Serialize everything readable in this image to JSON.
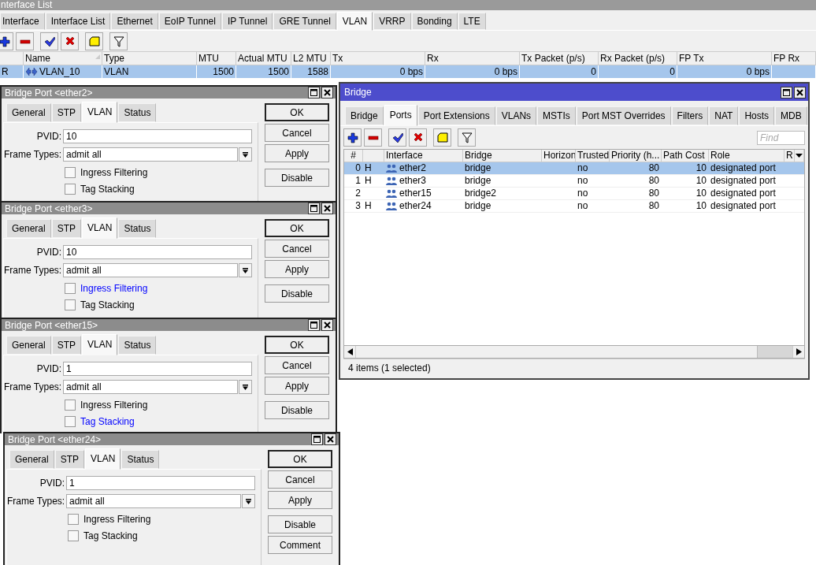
{
  "interface_list": {
    "title": "nterface List",
    "tabs": [
      {
        "label": "Interface",
        "selected": false
      },
      {
        "label": "Interface List",
        "selected": false
      },
      {
        "label": "Ethernet",
        "selected": false
      },
      {
        "label": "EoIP Tunnel",
        "selected": false
      },
      {
        "label": "IP Tunnel",
        "selected": false
      },
      {
        "label": "GRE Tunnel",
        "selected": false
      },
      {
        "label": "VLAN",
        "selected": true
      },
      {
        "label": "VRRP",
        "selected": false
      },
      {
        "label": "Bonding",
        "selected": false
      },
      {
        "label": "LTE",
        "selected": false
      }
    ],
    "table": {
      "columns": [
        "Name",
        "Type",
        "MTU",
        "Actual MTU",
        "L2 MTU",
        "Tx",
        "Rx",
        "Tx Packet (p/s)",
        "Rx Packet (p/s)",
        "FP Tx",
        "FP Rx"
      ],
      "rows": [
        {
          "flag": "R",
          "selected": true,
          "cells": [
            "VLAN_10",
            "VLAN",
            "1500",
            "1500",
            "1588",
            "0 bps",
            "0 bps",
            "0",
            "0",
            "0 bps"
          ]
        }
      ]
    }
  },
  "bridge": {
    "title": "Bridge",
    "tabs": [
      {
        "label": "Bridge",
        "selected": false
      },
      {
        "label": "Ports",
        "selected": true
      },
      {
        "label": "Port Extensions",
        "selected": false
      },
      {
        "label": "VLANs",
        "selected": false
      },
      {
        "label": "MSTIs",
        "selected": false
      },
      {
        "label": "Port MST Overrides",
        "selected": false
      },
      {
        "label": "Filters",
        "selected": false
      },
      {
        "label": "NAT",
        "selected": false
      },
      {
        "label": "Hosts",
        "selected": false
      },
      {
        "label": "MDB",
        "selected": false
      }
    ],
    "search": {
      "placeholder": "Find"
    },
    "table": {
      "columns": [
        "#",
        "Interface",
        "Bridge",
        "Horizon",
        "Trusted",
        "Priority (h...",
        "Path Cost",
        "Role",
        "R"
      ],
      "rows": [
        {
          "number": "0",
          "flag": "H",
          "interface": "ether2",
          "bridge": "bridge",
          "trusted": "no",
          "priority": "80",
          "path_cost": "10",
          "role": "designated port",
          "selected": true
        },
        {
          "number": "1",
          "flag": "H",
          "interface": "ether3",
          "bridge": "bridge",
          "trusted": "no",
          "priority": "80",
          "path_cost": "10",
          "role": "designated port",
          "selected": false
        },
        {
          "number": "2",
          "interface": "ether15",
          "bridge": "bridge2",
          "trusted": "no",
          "priority": "80",
          "path_cost": "10",
          "role": "designated port",
          "selected": false
        },
        {
          "number": "3",
          "flag": "H",
          "interface": "ether24",
          "bridge": "bridge",
          "trusted": "no",
          "priority": "80",
          "path_cost": "10",
          "role": "designated port",
          "selected": false
        }
      ]
    },
    "status_bar": "4 items (1 selected)"
  },
  "dialogs": [
    {
      "title": "Bridge Port <ether2>",
      "tabs": [
        {
          "label": "General",
          "selected": false
        },
        {
          "label": "STP",
          "selected": false
        },
        {
          "label": "VLAN",
          "selected": true
        },
        {
          "label": "Status",
          "selected": false
        }
      ],
      "fields": [
        {
          "kind": "text",
          "label": "PVID:",
          "value": "10"
        },
        {
          "kind": "dropdown",
          "label": "Frame Types:",
          "value": "admit all"
        }
      ],
      "checkboxes": [
        {
          "label": "Ingress Filtering",
          "checked": false,
          "highlighted": false
        },
        {
          "label": "Tag Stacking",
          "checked": false,
          "highlighted": false
        }
      ],
      "buttons": [
        {
          "label": "OK",
          "default": true
        },
        {
          "label": "Cancel",
          "default": false
        },
        {
          "label": "Apply",
          "default": false
        },
        {
          "label": "Disable",
          "default": false
        }
      ]
    },
    {
      "title": "Bridge Port <ether3>",
      "tabs": [
        {
          "label": "General",
          "selected": false
        },
        {
          "label": "STP",
          "selected": false
        },
        {
          "label": "VLAN",
          "selected": true
        },
        {
          "label": "Status",
          "selected": false
        }
      ],
      "fields": [
        {
          "kind": "text",
          "label": "PVID:",
          "value": "10"
        },
        {
          "kind": "dropdown",
          "label": "Frame Types:",
          "value": "admit all"
        }
      ],
      "checkboxes": [
        {
          "label": "Ingress Filtering",
          "checked": false,
          "highlighted": true
        },
        {
          "label": "Tag Stacking",
          "checked": false,
          "highlighted": false
        }
      ],
      "buttons": [
        {
          "label": "OK",
          "default": true
        },
        {
          "label": "Cancel",
          "default": false
        },
        {
          "label": "Apply",
          "default": false
        },
        {
          "label": "Disable",
          "default": false
        }
      ]
    },
    {
      "title": "Bridge Port <ether15>",
      "tabs": [
        {
          "label": "General",
          "selected": false
        },
        {
          "label": "STP",
          "selected": false
        },
        {
          "label": "VLAN",
          "selected": true
        },
        {
          "label": "Status",
          "selected": false
        }
      ],
      "fields": [
        {
          "kind": "text",
          "label": "PVID:",
          "value": "1"
        },
        {
          "kind": "dropdown",
          "label": "Frame Types:",
          "value": "admit all"
        }
      ],
      "checkboxes": [
        {
          "label": "Ingress Filtering",
          "checked": false,
          "highlighted": false
        },
        {
          "label": "Tag Stacking",
          "checked": false,
          "highlighted": true
        }
      ],
      "buttons": [
        {
          "label": "OK",
          "default": true
        },
        {
          "label": "Cancel",
          "default": false
        },
        {
          "label": "Apply",
          "default": false
        },
        {
          "label": "Disable",
          "default": false
        }
      ]
    },
    {
      "title": "Bridge Port <ether24>",
      "tabs": [
        {
          "label": "General",
          "selected": false
        },
        {
          "label": "STP",
          "selected": false
        },
        {
          "label": "VLAN",
          "selected": true
        },
        {
          "label": "Status",
          "selected": false
        }
      ],
      "fields": [
        {
          "kind": "text",
          "label": "PVID:",
          "value": "1"
        },
        {
          "kind": "dropdown",
          "label": "Frame Types:",
          "value": "admit all"
        }
      ],
      "checkboxes": [
        {
          "label": "Ingress Filtering",
          "checked": false,
          "highlighted": false
        },
        {
          "label": "Tag Stacking",
          "checked": false,
          "highlighted": false
        }
      ],
      "buttons": [
        {
          "label": "OK",
          "default": true
        },
        {
          "label": "Cancel",
          "default": false
        },
        {
          "label": "Apply",
          "default": false
        },
        {
          "label": "Disable",
          "default": false
        },
        {
          "label": "Comment",
          "default": false
        }
      ]
    }
  ]
}
